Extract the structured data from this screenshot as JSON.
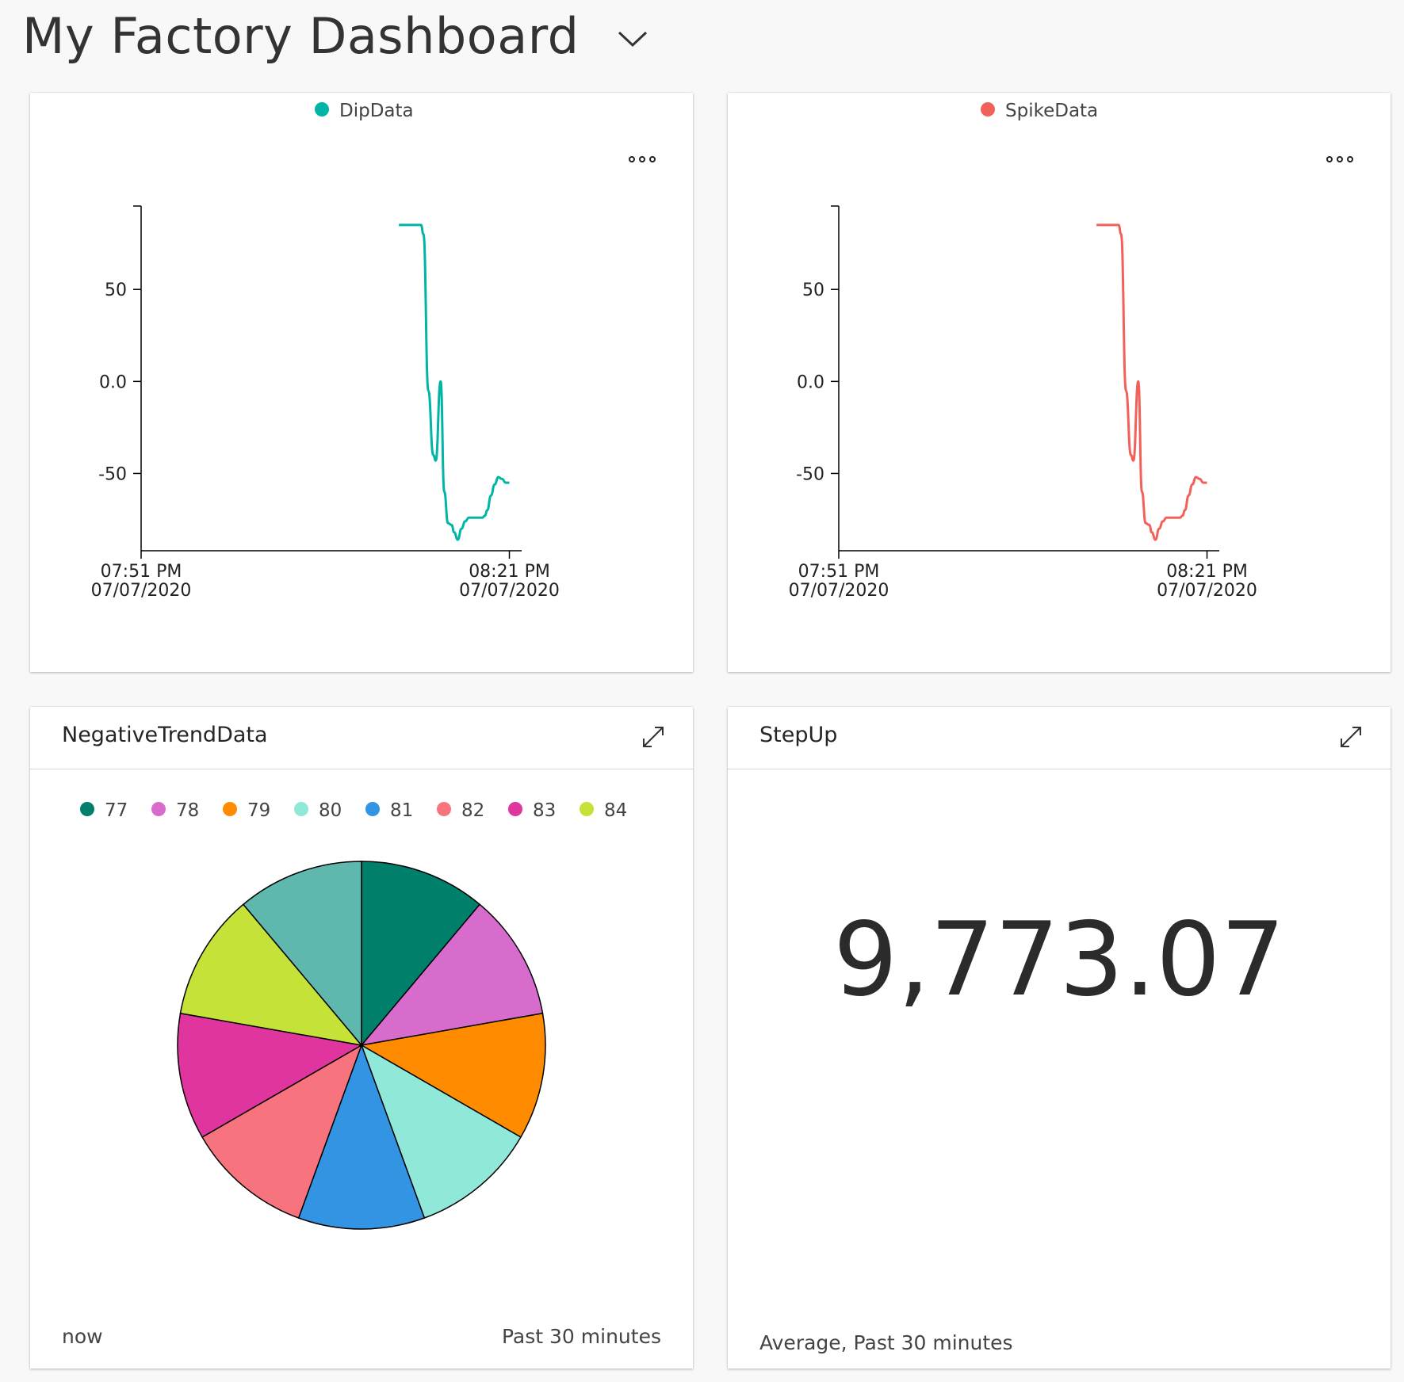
{
  "dashboard": {
    "title": "My Factory Dashboard"
  },
  "dip": {
    "legend": "DipData",
    "color": "#00b5a6",
    "chart_data": {
      "type": "line",
      "title": "",
      "series": [
        {
          "name": "DipData",
          "color": "#00b5a6",
          "x_min": [
            0,
            1.8,
            2.0,
            2.4,
            2.8,
            3.0,
            3.4,
            3.7,
            4.0,
            4.3,
            4.5,
            4.8,
            5.1,
            5.4,
            5.7,
            6.0,
            6.4,
            6.8,
            7.0,
            7.2,
            7.5,
            7.8,
            8.1,
            8.4,
            8.7,
            9.0
          ],
          "values": [
            85,
            85,
            80,
            -5,
            -40,
            -43,
            0,
            -60,
            -77,
            -78,
            -82,
            -86,
            -80,
            -76,
            -74,
            -74,
            -74,
            -74,
            -73,
            -70,
            -62,
            -56,
            -52,
            -53,
            -55,
            -55
          ]
        }
      ],
      "x_start_min": 21,
      "x_ticks": [
        {
          "at_min": 0,
          "time": "07:51 PM",
          "date": "07/07/2020"
        },
        {
          "at_min": 30,
          "time": "08:21 PM",
          "date": "07/07/2020"
        }
      ],
      "y_ticks": [
        {
          "value": 50,
          "label": "50"
        },
        {
          "value": 0,
          "label": "0.0"
        },
        {
          "value": -50,
          "label": "-50"
        }
      ],
      "ylim": [
        -92,
        91
      ],
      "xlim": [
        0,
        31
      ]
    }
  },
  "spike": {
    "legend": "SpikeData",
    "color": "#f2605a",
    "chart_data": {
      "type": "line",
      "title": "",
      "series": [
        {
          "name": "SpikeData",
          "color": "#f2605a",
          "x_min": [
            0,
            1.8,
            2.0,
            2.4,
            2.8,
            3.0,
            3.4,
            3.7,
            4.0,
            4.3,
            4.5,
            4.8,
            5.1,
            5.4,
            5.7,
            6.0,
            6.4,
            6.8,
            7.0,
            7.2,
            7.5,
            7.8,
            8.1,
            8.4,
            8.7,
            9.0
          ],
          "values": [
            85,
            85,
            80,
            -5,
            -40,
            -43,
            0,
            -60,
            -77,
            -78,
            -82,
            -86,
            -80,
            -76,
            -74,
            -74,
            -74,
            -74,
            -73,
            -70,
            -62,
            -56,
            -52,
            -53,
            -55,
            -55
          ]
        }
      ],
      "x_start_min": 21,
      "x_ticks": [
        {
          "at_min": 0,
          "time": "07:51 PM",
          "date": "07/07/2020"
        },
        {
          "at_min": 30,
          "time": "08:21 PM",
          "date": "07/07/2020"
        }
      ],
      "y_ticks": [
        {
          "value": 50,
          "label": "50"
        },
        {
          "value": 0,
          "label": "0.0"
        },
        {
          "value": -50,
          "label": "-50"
        }
      ],
      "ylim": [
        -92,
        91
      ],
      "xlim": [
        0,
        31
      ]
    }
  },
  "negative": {
    "title": "NegativeTrendData",
    "footer_left": "now",
    "footer_right": "Past 30 minutes",
    "chart_data": {
      "type": "pie",
      "title": "",
      "slices": [
        {
          "label": "77",
          "value": 1,
          "color": "#00806b"
        },
        {
          "label": "78",
          "value": 1,
          "color": "#d86ccc"
        },
        {
          "label": "79",
          "value": 1,
          "color": "#ff8c00"
        },
        {
          "label": "80",
          "value": 1,
          "color": "#8fe8d8"
        },
        {
          "label": "81",
          "value": 1,
          "color": "#3294e2"
        },
        {
          "label": "82",
          "value": 1,
          "color": "#f7737e"
        },
        {
          "label": "83",
          "value": 1,
          "color": "#e0349e"
        },
        {
          "label": "84",
          "value": 1,
          "color": "#c5e238"
        },
        {
          "label": "",
          "value": 1,
          "color": "#5fb8ae"
        }
      ]
    }
  },
  "step": {
    "title": "StepUp",
    "value": "9,773.07",
    "footer": "Average, Past 30 minutes"
  }
}
